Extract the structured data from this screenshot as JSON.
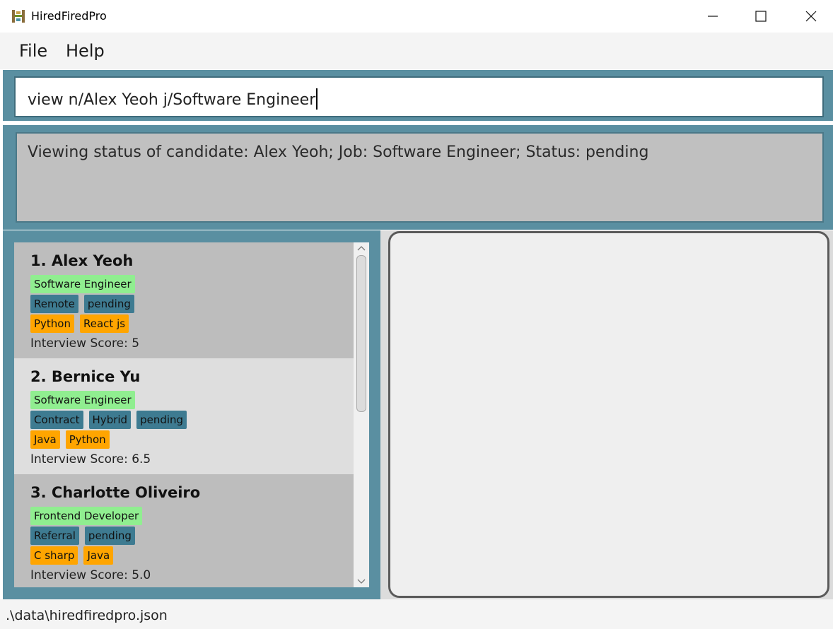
{
  "window": {
    "title": "HiredFiredPro",
    "icon": "app-logo-icon",
    "controls": [
      "minimize-icon",
      "maximize-icon",
      "close-icon"
    ]
  },
  "menu": {
    "file_label": "File",
    "help_label": "Help"
  },
  "command": {
    "value": "view n/Alex Yeoh j/Software Engineer"
  },
  "result": {
    "message": "Viewing status of candidate: Alex Yeoh; Job: Software Engineer; Status: pending"
  },
  "candidates": [
    {
      "name": "1. Alex Yeoh",
      "job": "Software Engineer",
      "status_tags": [
        "Remote",
        "pending"
      ],
      "skills": [
        "Python",
        "React js"
      ],
      "score": "Interview Score: 5"
    },
    {
      "name": "2. Bernice Yu",
      "job": "Software Engineer",
      "status_tags": [
        "Contract",
        "Hybrid",
        "pending"
      ],
      "skills": [
        "Java",
        "Python"
      ],
      "score": "Interview Score: 6.5"
    },
    {
      "name": "3. Charlotte Oliveiro",
      "job": "Frontend Developer",
      "status_tags": [
        "Referral",
        "pending"
      ],
      "skills": [
        "C sharp",
        "Java"
      ],
      "score": "Interview Score: 5.0"
    }
  ],
  "status_bar": {
    "path": ".\\data\\hiredfiredpro.json"
  },
  "colors": {
    "accent_band": "#5a8fa1",
    "job_tag": "#90ee90",
    "status_tag": "#3e7b91",
    "skill_tag": "#ffa500"
  }
}
